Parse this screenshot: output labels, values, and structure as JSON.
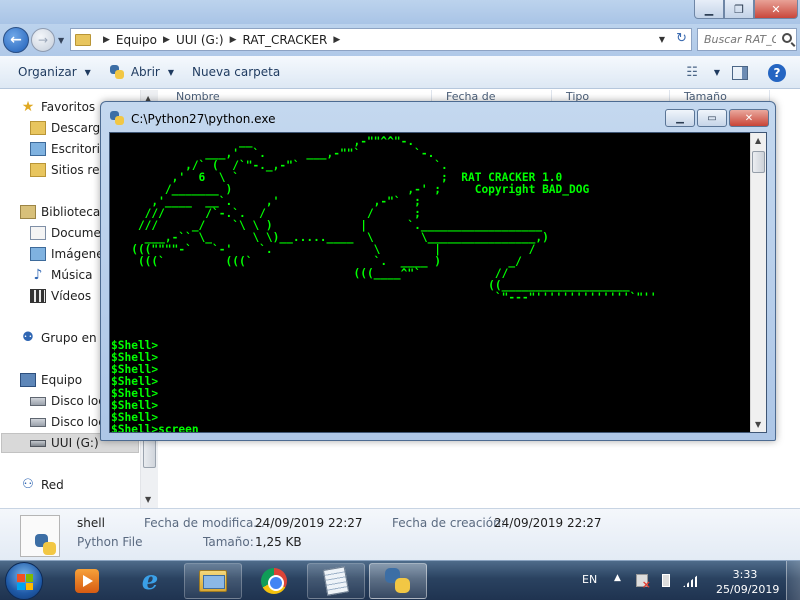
{
  "explorer": {
    "breadcrumb": [
      "Equipo",
      "UUI (G:)",
      "RAT_CRACKER"
    ],
    "search_placeholder": "Buscar RAT_CRACKER",
    "toolbar": {
      "organize": "Organizar",
      "open": "Abrir",
      "new_folder": "Nueva carpeta"
    },
    "columns": [
      "Nombre",
      "Fecha de modifica...",
      "Tipo",
      "Tamaño"
    ],
    "nav": {
      "favorites": "Favoritos",
      "downloads": "Descargas",
      "desktop": "Escritorio",
      "recent": "Sitios recientes",
      "libraries": "Bibliotecas",
      "documents": "Documentos",
      "images": "Imágenes",
      "music": "Música",
      "videos": "Vídeos",
      "homegroup": "Grupo en el hogar",
      "computer": "Equipo",
      "disk1": "Disco local (C:)",
      "disk2": "Disco local (D:)",
      "usb": "UUI (G:)",
      "network": "Red"
    },
    "details": {
      "name": "shell",
      "type": "Python File",
      "modified_label": "Fecha de modifica...",
      "modified_value": "24/09/2019 22:27",
      "created_label": "Fecha de creación:",
      "created_value": "24/09/2019 22:27",
      "size_label": "Tamaño:",
      "size_value": "1,25 KB"
    }
  },
  "console": {
    "title": "C:\\Python27\\python.exe",
    "output": "                   __               ,-\"\"^^\"-.\n              ___,'  `.      ___,-\"\"`        `-.\n           ,/` (  /`\"-._,-\"`                    `.\n         ,'  6  \\ `                              ;  RAT CRACKER 1.0\n        /_______ )                          ,-' ;     Copyright BAD_DOG\n      ,'____  __`.     ,'              ,-\"`  ;\n     ///      /`-.`.  /               /      ;\n    ///     _/    `\\ \\ )             |      `.__________________\n     ___,-`` \\_      \\ \\)__.....____  \\       \\________________,)\n   (((\"\"\"\"-`   `-'    `.               \\        |             /\n    (((`         (((`                  `.  ____ )          _/\n                                    (((____^\"`           //\n                                                        ((___________________\n                                                         `\"---\"''''''''''''''`\"''\n\n\n\n$Shell>\n$Shell>\n$Shell>\n$Shell>\n$Shell>\n$Shell>\n$Shell>\n$Shell>screen"
  },
  "taskbar": {
    "lang": "EN",
    "time": "3:33",
    "date": "25/09/2019"
  }
}
